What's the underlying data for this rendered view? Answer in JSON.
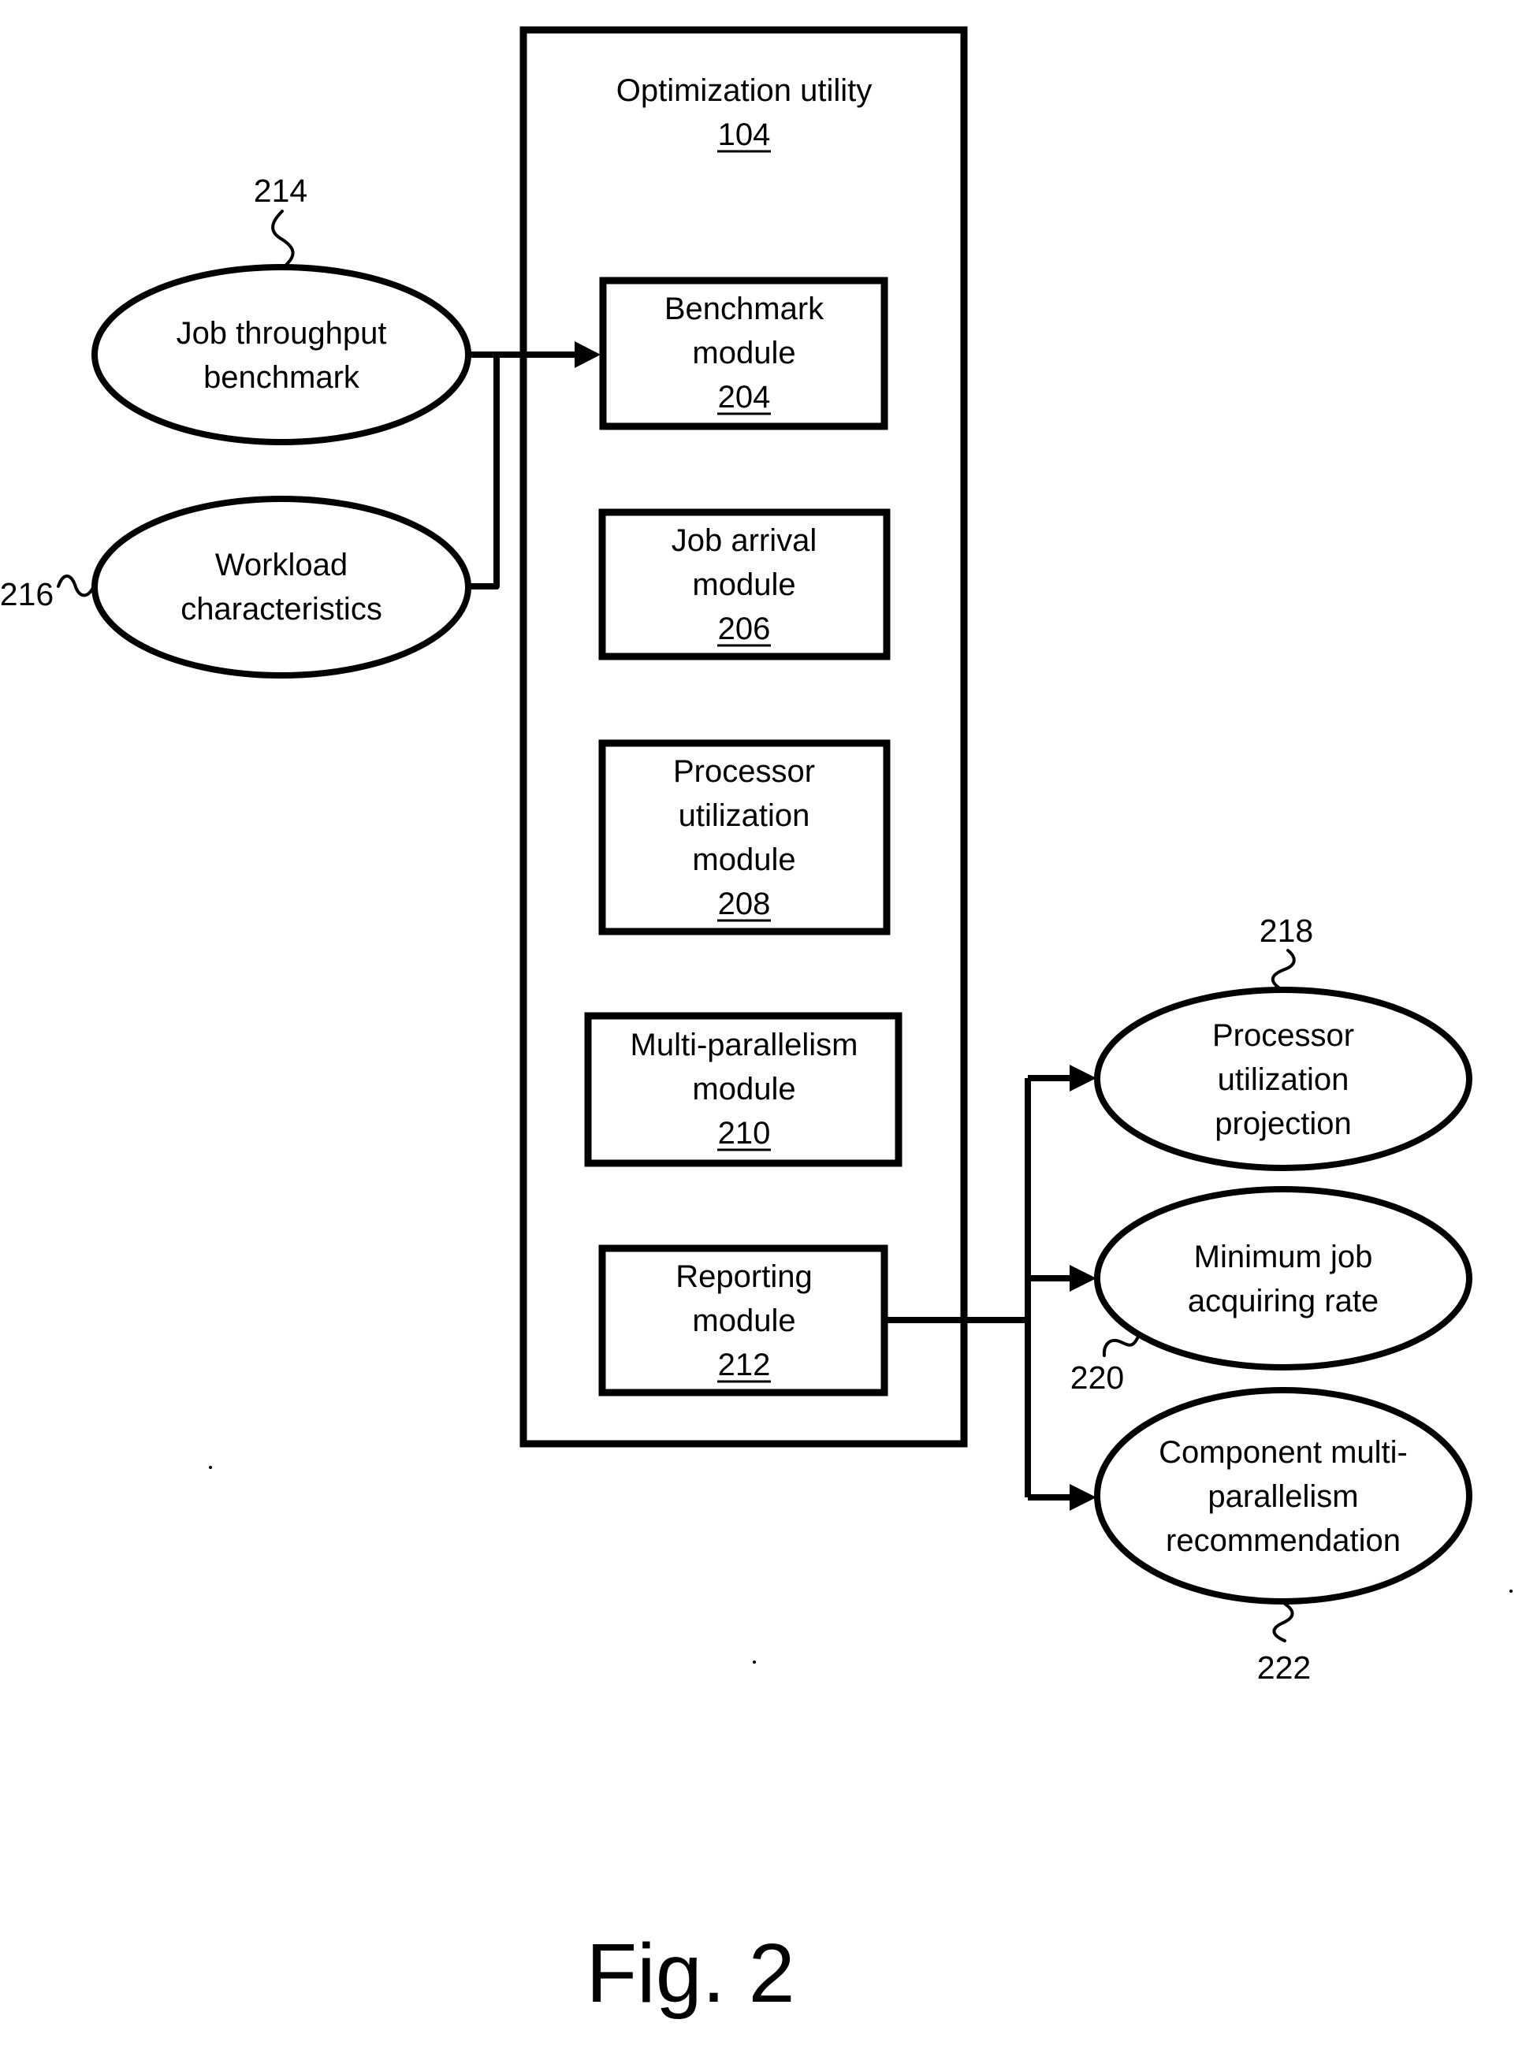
{
  "figure": {
    "caption": "Fig. 2",
    "container": {
      "title": "Optimization utility",
      "ref": "104"
    },
    "modules": [
      {
        "id": "benchmark",
        "lines": [
          "Benchmark",
          "module"
        ],
        "ref": "204"
      },
      {
        "id": "job-arrival",
        "lines": [
          "Job arrival",
          "module"
        ],
        "ref": "206"
      },
      {
        "id": "processor-util",
        "lines": [
          "Processor",
          "utilization",
          "module"
        ],
        "ref": "208"
      },
      {
        "id": "multi-parallel",
        "lines": [
          "Multi-parallelism",
          "module"
        ],
        "ref": "210"
      },
      {
        "id": "reporting",
        "lines": [
          "Reporting",
          "module"
        ],
        "ref": "212"
      }
    ],
    "inputs": [
      {
        "id": "job-throughput-benchmark",
        "lines": [
          "Job throughput",
          "benchmark"
        ],
        "ref": "214"
      },
      {
        "id": "workload-characteristics",
        "lines": [
          "Workload",
          "characteristics"
        ],
        "ref": "216"
      }
    ],
    "outputs": [
      {
        "id": "processor-utilization-projection",
        "lines": [
          "Processor",
          "utilization",
          "projection"
        ],
        "ref": "218"
      },
      {
        "id": "minimum-job-acquiring-rate",
        "lines": [
          "Minimum job",
          "acquiring rate"
        ],
        "ref": "220"
      },
      {
        "id": "component-multi-parallelism-rec",
        "lines": [
          "Component multi-",
          "parallelism",
          "recommendation"
        ],
        "ref": "222"
      }
    ],
    "colors": {
      "ink": "#000000",
      "paper": "#ffffff"
    }
  }
}
